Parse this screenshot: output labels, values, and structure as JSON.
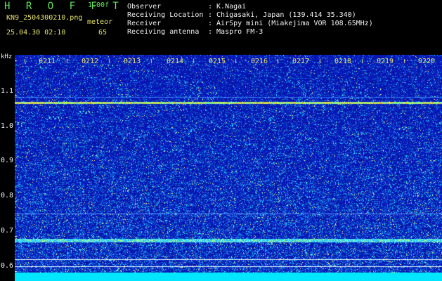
{
  "app": {
    "title": "H R O F F T",
    "version": "1.00f"
  },
  "info": {
    "filename": "KN9_2504300210.png",
    "meteor_label": "meteor",
    "timestamp": "25.04.30 02:10",
    "meteor_count": "65"
  },
  "meta": [
    {
      "key": "Observer",
      "value": ": K.Nagai"
    },
    {
      "key": "Receiving Location",
      "value": ": Chigasaki, Japan (139.414 35.340)"
    },
    {
      "key": "Receiver",
      "value": ": AirSpy mini (Miakejima VOR 108.65MHz)"
    },
    {
      "key": "Receiving antenna",
      "value": ": Maspro FM-3"
    }
  ],
  "axis": {
    "unit": "kHz",
    "y_ticks": [
      "1.1",
      "1.0",
      "0.9",
      "0.8",
      "0.7",
      "0.6"
    ],
    "x_ticks": [
      "0211",
      "0212",
      "0213",
      "0214",
      "0215",
      "0216",
      "0217",
      "0218",
      "0219",
      "0220"
    ]
  },
  "colors": {
    "background": "#000000",
    "title": "#5fe35a",
    "label": "#e7e26a",
    "text": "#f2f2f2",
    "noise": "#0a1fae",
    "band": "#00e6ff"
  }
}
